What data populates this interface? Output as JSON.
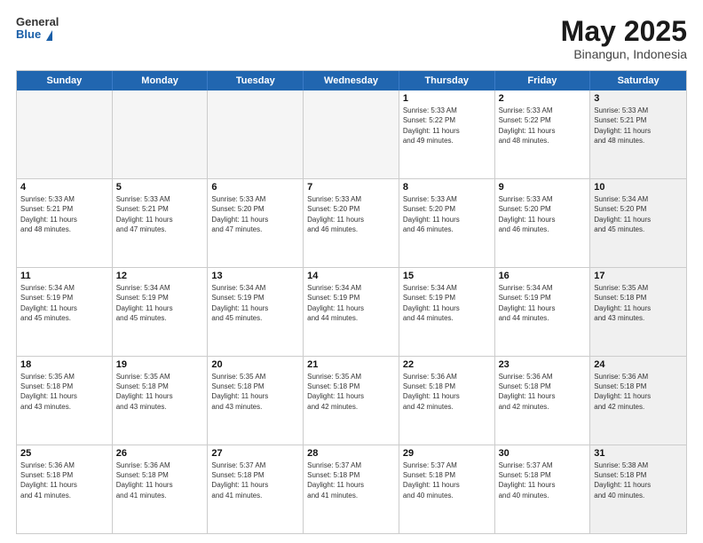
{
  "logo": {
    "general": "General",
    "blue": "Blue"
  },
  "title": "May 2025",
  "location": "Binangun, Indonesia",
  "days_of_week": [
    "Sunday",
    "Monday",
    "Tuesday",
    "Wednesday",
    "Thursday",
    "Friday",
    "Saturday"
  ],
  "rows": [
    [
      {
        "day": "",
        "info": "",
        "empty": true
      },
      {
        "day": "",
        "info": "",
        "empty": true
      },
      {
        "day": "",
        "info": "",
        "empty": true
      },
      {
        "day": "",
        "info": "",
        "empty": true
      },
      {
        "day": "1",
        "info": "Sunrise: 5:33 AM\nSunset: 5:22 PM\nDaylight: 11 hours\nand 49 minutes.",
        "empty": false
      },
      {
        "day": "2",
        "info": "Sunrise: 5:33 AM\nSunset: 5:22 PM\nDaylight: 11 hours\nand 48 minutes.",
        "empty": false
      },
      {
        "day": "3",
        "info": "Sunrise: 5:33 AM\nSunset: 5:21 PM\nDaylight: 11 hours\nand 48 minutes.",
        "empty": false,
        "shaded": true
      }
    ],
    [
      {
        "day": "4",
        "info": "Sunrise: 5:33 AM\nSunset: 5:21 PM\nDaylight: 11 hours\nand 48 minutes.",
        "empty": false
      },
      {
        "day": "5",
        "info": "Sunrise: 5:33 AM\nSunset: 5:21 PM\nDaylight: 11 hours\nand 47 minutes.",
        "empty": false
      },
      {
        "day": "6",
        "info": "Sunrise: 5:33 AM\nSunset: 5:20 PM\nDaylight: 11 hours\nand 47 minutes.",
        "empty": false
      },
      {
        "day": "7",
        "info": "Sunrise: 5:33 AM\nSunset: 5:20 PM\nDaylight: 11 hours\nand 46 minutes.",
        "empty": false
      },
      {
        "day": "8",
        "info": "Sunrise: 5:33 AM\nSunset: 5:20 PM\nDaylight: 11 hours\nand 46 minutes.",
        "empty": false
      },
      {
        "day": "9",
        "info": "Sunrise: 5:33 AM\nSunset: 5:20 PM\nDaylight: 11 hours\nand 46 minutes.",
        "empty": false
      },
      {
        "day": "10",
        "info": "Sunrise: 5:34 AM\nSunset: 5:20 PM\nDaylight: 11 hours\nand 45 minutes.",
        "empty": false,
        "shaded": true
      }
    ],
    [
      {
        "day": "11",
        "info": "Sunrise: 5:34 AM\nSunset: 5:19 PM\nDaylight: 11 hours\nand 45 minutes.",
        "empty": false
      },
      {
        "day": "12",
        "info": "Sunrise: 5:34 AM\nSunset: 5:19 PM\nDaylight: 11 hours\nand 45 minutes.",
        "empty": false
      },
      {
        "day": "13",
        "info": "Sunrise: 5:34 AM\nSunset: 5:19 PM\nDaylight: 11 hours\nand 45 minutes.",
        "empty": false
      },
      {
        "day": "14",
        "info": "Sunrise: 5:34 AM\nSunset: 5:19 PM\nDaylight: 11 hours\nand 44 minutes.",
        "empty": false
      },
      {
        "day": "15",
        "info": "Sunrise: 5:34 AM\nSunset: 5:19 PM\nDaylight: 11 hours\nand 44 minutes.",
        "empty": false
      },
      {
        "day": "16",
        "info": "Sunrise: 5:34 AM\nSunset: 5:19 PM\nDaylight: 11 hours\nand 44 minutes.",
        "empty": false
      },
      {
        "day": "17",
        "info": "Sunrise: 5:35 AM\nSunset: 5:18 PM\nDaylight: 11 hours\nand 43 minutes.",
        "empty": false,
        "shaded": true
      }
    ],
    [
      {
        "day": "18",
        "info": "Sunrise: 5:35 AM\nSunset: 5:18 PM\nDaylight: 11 hours\nand 43 minutes.",
        "empty": false
      },
      {
        "day": "19",
        "info": "Sunrise: 5:35 AM\nSunset: 5:18 PM\nDaylight: 11 hours\nand 43 minutes.",
        "empty": false
      },
      {
        "day": "20",
        "info": "Sunrise: 5:35 AM\nSunset: 5:18 PM\nDaylight: 11 hours\nand 43 minutes.",
        "empty": false
      },
      {
        "day": "21",
        "info": "Sunrise: 5:35 AM\nSunset: 5:18 PM\nDaylight: 11 hours\nand 42 minutes.",
        "empty": false
      },
      {
        "day": "22",
        "info": "Sunrise: 5:36 AM\nSunset: 5:18 PM\nDaylight: 11 hours\nand 42 minutes.",
        "empty": false
      },
      {
        "day": "23",
        "info": "Sunrise: 5:36 AM\nSunset: 5:18 PM\nDaylight: 11 hours\nand 42 minutes.",
        "empty": false
      },
      {
        "day": "24",
        "info": "Sunrise: 5:36 AM\nSunset: 5:18 PM\nDaylight: 11 hours\nand 42 minutes.",
        "empty": false,
        "shaded": true
      }
    ],
    [
      {
        "day": "25",
        "info": "Sunrise: 5:36 AM\nSunset: 5:18 PM\nDaylight: 11 hours\nand 41 minutes.",
        "empty": false
      },
      {
        "day": "26",
        "info": "Sunrise: 5:36 AM\nSunset: 5:18 PM\nDaylight: 11 hours\nand 41 minutes.",
        "empty": false
      },
      {
        "day": "27",
        "info": "Sunrise: 5:37 AM\nSunset: 5:18 PM\nDaylight: 11 hours\nand 41 minutes.",
        "empty": false
      },
      {
        "day": "28",
        "info": "Sunrise: 5:37 AM\nSunset: 5:18 PM\nDaylight: 11 hours\nand 41 minutes.",
        "empty": false
      },
      {
        "day": "29",
        "info": "Sunrise: 5:37 AM\nSunset: 5:18 PM\nDaylight: 11 hours\nand 40 minutes.",
        "empty": false
      },
      {
        "day": "30",
        "info": "Sunrise: 5:37 AM\nSunset: 5:18 PM\nDaylight: 11 hours\nand 40 minutes.",
        "empty": false
      },
      {
        "day": "31",
        "info": "Sunrise: 5:38 AM\nSunset: 5:18 PM\nDaylight: 11 hours\nand 40 minutes.",
        "empty": false,
        "shaded": true
      }
    ]
  ]
}
